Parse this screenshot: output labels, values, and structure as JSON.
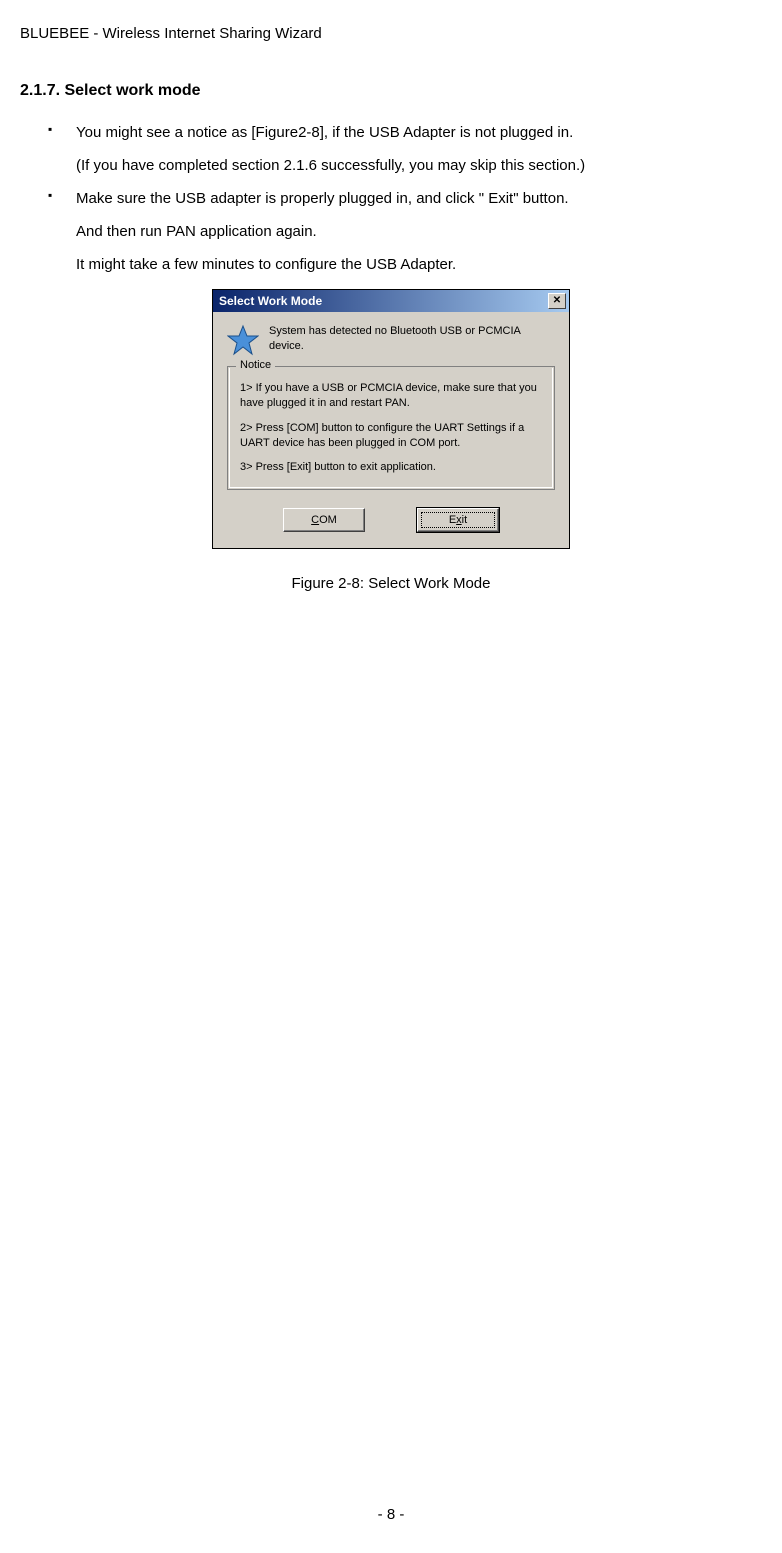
{
  "header": "BLUEBEE - Wireless Internet Sharing Wizard",
  "section_title": "2.1.7. Select work mode",
  "bullets": [
    "You might see a notice as [Figure2-8], if the USB Adapter is not plugged in.",
    "Make sure the USB adapter is properly plugged in, and click \" Exit\"  button."
  ],
  "sub_lines": {
    "a": "(If you have completed section 2.1.6 successfully, you may skip this section.)",
    "b": "And then run PAN application again.",
    "c": "It might take a few minutes to configure the USB Adapter."
  },
  "dialog": {
    "title": "Select Work Mode",
    "close": "r",
    "top_msg": "System has detected no Bluetooth USB or PCMCIA device.",
    "fieldset_legend": "Notice",
    "notices": [
      "1> If you have a USB or PCMCIA device, make sure that you have plugged it in and restart PAN.",
      "2> Press [COM] button to configure the UART Settings if a UART device has been plugged in COM port.",
      "3> Press [Exit] button to exit application."
    ],
    "btn_com_pre": "",
    "btn_com_ul": "C",
    "btn_com_post": "OM",
    "btn_exit_pre": "E",
    "btn_exit_ul": "x",
    "btn_exit_post": "it"
  },
  "figure_caption": "Figure 2-8: Select Work Mode",
  "page_num": "- 8 -"
}
